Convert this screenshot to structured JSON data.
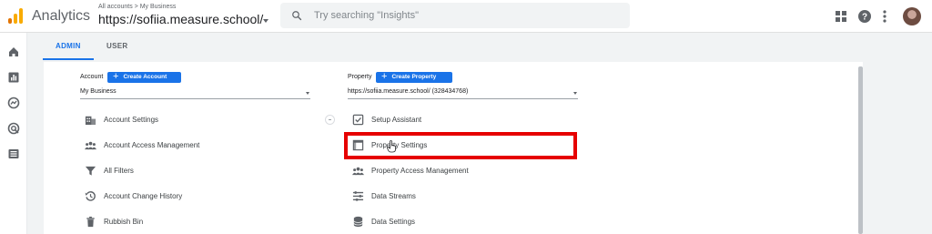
{
  "header": {
    "app_title": "Analytics",
    "breadcrumb": "All accounts > My Business",
    "account_name": "https://sofiia.measure.school/",
    "search_placeholder": "Try searching \"Insights\""
  },
  "tabs": [
    {
      "label": "ADMIN",
      "active": true
    },
    {
      "label": "USER",
      "active": false
    }
  ],
  "account_column": {
    "label": "Account",
    "create_label": "Create Account",
    "selected": "My Business",
    "items": [
      {
        "label": "Account Settings",
        "icon": "building-icon"
      },
      {
        "label": "Account Access Management",
        "icon": "people-icon"
      },
      {
        "label": "All Filters",
        "icon": "filter-icon"
      },
      {
        "label": "Account Change History",
        "icon": "history-icon"
      },
      {
        "label": "Rubbish Bin",
        "icon": "trash-icon"
      }
    ]
  },
  "property_column": {
    "label": "Property",
    "create_label": "Create Property",
    "selected": "https://sofiia.measure.school/ (328434768)",
    "items": [
      {
        "label": "Setup Assistant",
        "icon": "checkbox-icon"
      },
      {
        "label": "Property Settings",
        "icon": "property-settings-icon",
        "highlighted": true
      },
      {
        "label": "Property Access Management",
        "icon": "people-icon"
      },
      {
        "label": "Data Streams",
        "icon": "streams-icon"
      },
      {
        "label": "Data Settings",
        "icon": "database-icon"
      }
    ]
  },
  "colors": {
    "accent": "#1a73e8",
    "highlight": "#e60000",
    "logo_orange": "#f9ab00",
    "logo_dark": "#e37400"
  }
}
